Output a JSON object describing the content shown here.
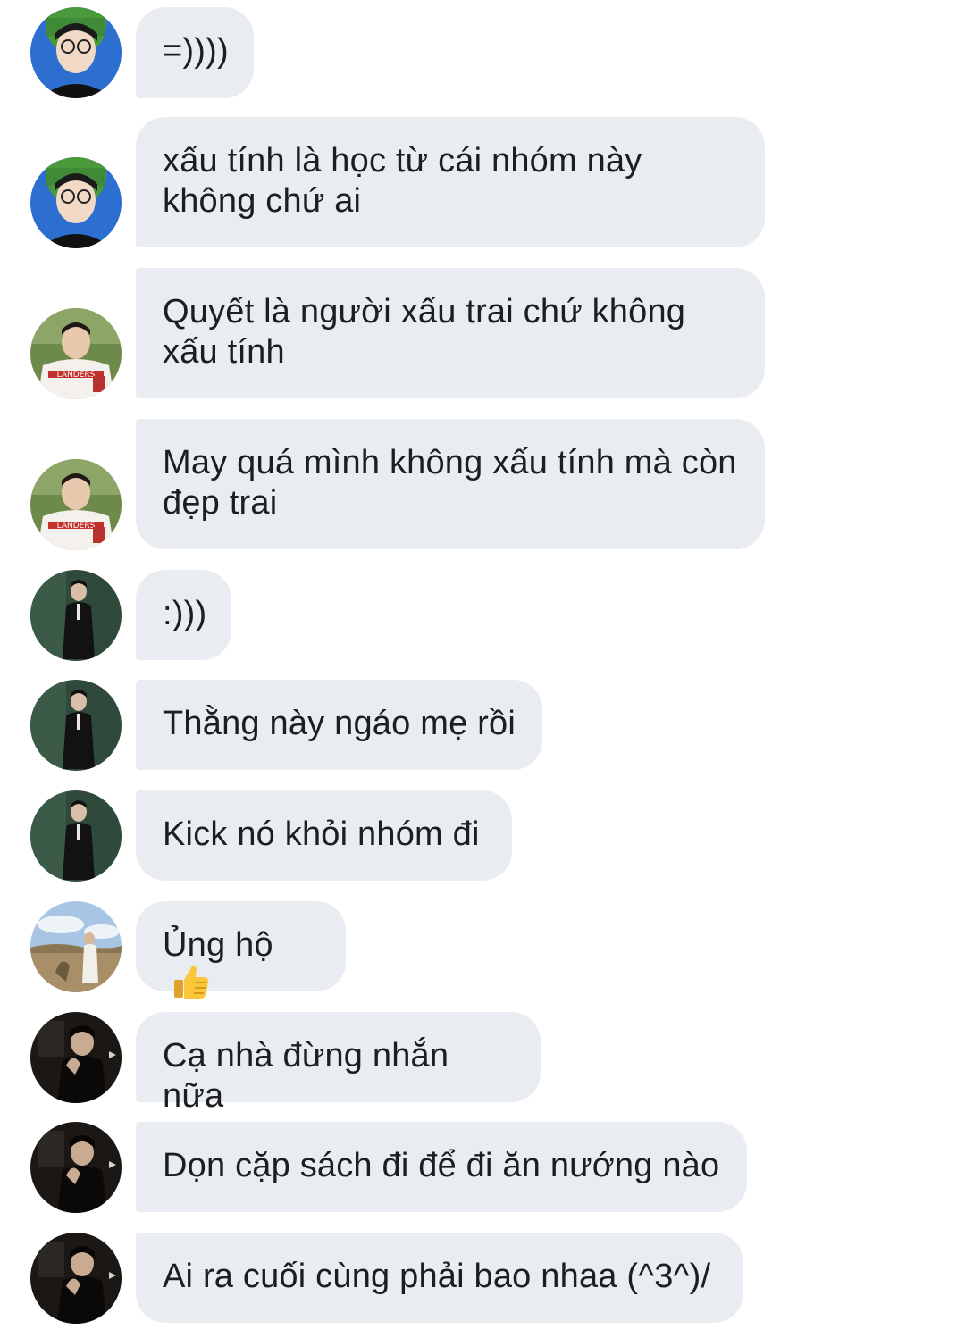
{
  "messages": [
    {
      "sender": "user-green-hat",
      "text": "=))))"
    },
    {
      "sender": "user-green-hat",
      "text": "xấu tính là học từ cái nhóm này không chứ ai"
    },
    {
      "sender": "user-landers-jersey",
      "text": "Quyết là người xấu trai chứ không xấu tính"
    },
    {
      "sender": "user-landers-jersey",
      "text": "May quá mình không xấu tính mà còn đẹp trai"
    },
    {
      "sender": "user-black-suit",
      "text": ":)))"
    },
    {
      "sender": "user-black-suit",
      "text": "Thằng này ngáo mẹ rồi"
    },
    {
      "sender": "user-black-suit",
      "text": "Kick nó khỏi nhóm đi"
    },
    {
      "sender": "user-field-photo",
      "text": "Ủng hộ",
      "emoji": "thumbs-up"
    },
    {
      "sender": "user-dark-photo",
      "text": "Cạ nhà đừng nhắn nữa"
    },
    {
      "sender": "user-dark-photo",
      "text": "Dọn cặp sách đi để đi ăn nướng nào"
    },
    {
      "sender": "user-dark-photo",
      "text": "Ai ra cuối cùng phải bao nhaa (^3^)/"
    }
  ],
  "theme": {
    "bubble_color": "#e9ecf0",
    "text_color": "#1c1e21",
    "background": "#ffffff"
  }
}
